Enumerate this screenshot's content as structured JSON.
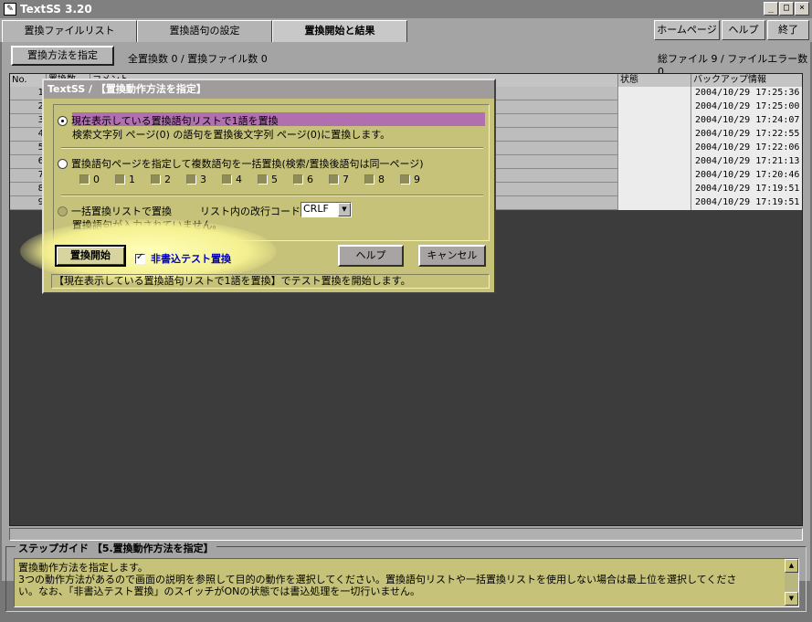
{
  "window": {
    "title": "TextSS 3.20",
    "app_icon": "textss-app-icon",
    "minimize": "_",
    "maximize": "□",
    "close": "×"
  },
  "tabs": [
    {
      "label": "置換ファイルリスト"
    },
    {
      "label": "置換語句の設定"
    },
    {
      "label": "置換開始と結果"
    }
  ],
  "top_buttons": {
    "homepage": "ホームページ",
    "help": "ヘルプ",
    "exit": "終了"
  },
  "toolbar": {
    "method_button": "置換方法を指定",
    "total_replacements": "全置換数 0 / 置換ファイル数 0",
    "total_files": "総ファイル 9 / ファイルエラー数 0"
  },
  "table": {
    "headers": {
      "no": "No.",
      "count": "置換数",
      "comment": "コメント",
      "status": "状態",
      "backup": "バックアップ情報"
    },
    "rows": [
      {
        "no": "1",
        "backup": "2004/10/29 17:25:36"
      },
      {
        "no": "2",
        "backup": "2004/10/29 17:25:00"
      },
      {
        "no": "3",
        "backup": "2004/10/29 17:24:07"
      },
      {
        "no": "4",
        "backup": "2004/10/29 17:22:55"
      },
      {
        "no": "5",
        "backup": "2004/10/29 17:22:06"
      },
      {
        "no": "6",
        "backup": "2004/10/29 17:21:13"
      },
      {
        "no": "7",
        "backup": "2004/10/29 17:20:46"
      },
      {
        "no": "8",
        "backup": "2004/10/29 17:19:51"
      },
      {
        "no": "9",
        "backup": "2004/10/29 17:19:51"
      }
    ]
  },
  "dialog": {
    "title": "TextSS / 【置換動作方法を指定】",
    "option1": {
      "label": "現在表示している置換語句リストで1語を置換",
      "desc": "検索文字列 ページ(0) の語句を置換後文字列 ページ(0)に置換します。"
    },
    "option2": {
      "label": "置換語句ページを指定して複数語句を一括置換(検索/置換後語句は同一ページ)",
      "pages": [
        "0",
        "1",
        "2",
        "3",
        "4",
        "5",
        "6",
        "7",
        "8",
        "9"
      ]
    },
    "option3": {
      "label": "一括置換リストで置換",
      "newline_label": "リスト内の改行コード",
      "newline_value": "CRLF",
      "desc": "置換語句が入力されていません。"
    },
    "start_button": "置換開始",
    "test_checkbox": "非書込テスト置換",
    "help_button": "ヘルプ",
    "cancel_button": "キャンセル",
    "status": "【現在表示している置換語句リストで1語を置換】でテスト置換を開始します。"
  },
  "guide": {
    "title": "ステップガイド 【5.置換動作方法を指定】",
    "lines": [
      "置換動作方法を指定します。",
      "3つの動作方法があるので画面の説明を参照して目的の動作を選択してください。置換語句リストや一括置換リストを使用しない場合は最上位を選択してくださ",
      "い。なお、「非書込テスト置換」のスイッチがONの状態では書込処理を一切行いません。"
    ]
  }
}
